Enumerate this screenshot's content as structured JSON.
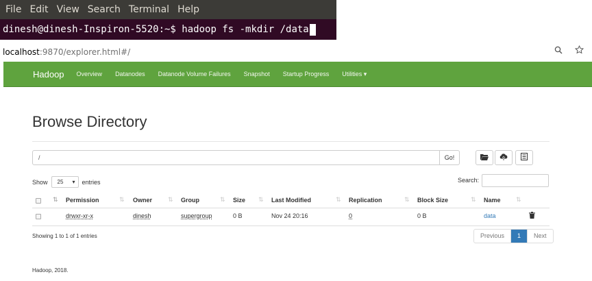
{
  "terminal": {
    "menu": [
      "File",
      "Edit",
      "View",
      "Search",
      "Terminal",
      "Help"
    ],
    "prompt": "dinesh@dinesh-Inspiron-5520:~$",
    "command": " hadoop fs -mkdir /data"
  },
  "browser": {
    "url_host": "localhost",
    "url_rest": ":9870/explorer.html#/",
    "zoom_icon": "magnifier-icon",
    "star_icon": "star-icon"
  },
  "navbar": {
    "brand": "Hadoop",
    "items": [
      "Overview",
      "Datanodes",
      "Datanode Volume Failures",
      "Snapshot",
      "Startup Progress",
      "Utilities ▾"
    ],
    "color": "#5fa33e"
  },
  "main": {
    "title": "Browse Directory",
    "path_value": "/",
    "go_label": "Go!",
    "show_label": "Show",
    "entries_value": "25",
    "entries_label": "entries",
    "search_label": "Search:",
    "columns": [
      "Permission",
      "Owner",
      "Group",
      "Size",
      "Last Modified",
      "Replication",
      "Block Size",
      "Name"
    ],
    "rows": [
      {
        "permission": "drwxr-xr-x",
        "owner": "dinesh",
        "group": "supergroup",
        "size": "0 B",
        "last_modified": "Nov 24 20:16",
        "replication": "0",
        "block_size": "0 B",
        "name": "data"
      }
    ],
    "info": "Showing 1 to 1 of 1 entries",
    "pagination": {
      "previous": "Previous",
      "current": "1",
      "next": "Next"
    },
    "footer": "Hadoop, 2018."
  }
}
